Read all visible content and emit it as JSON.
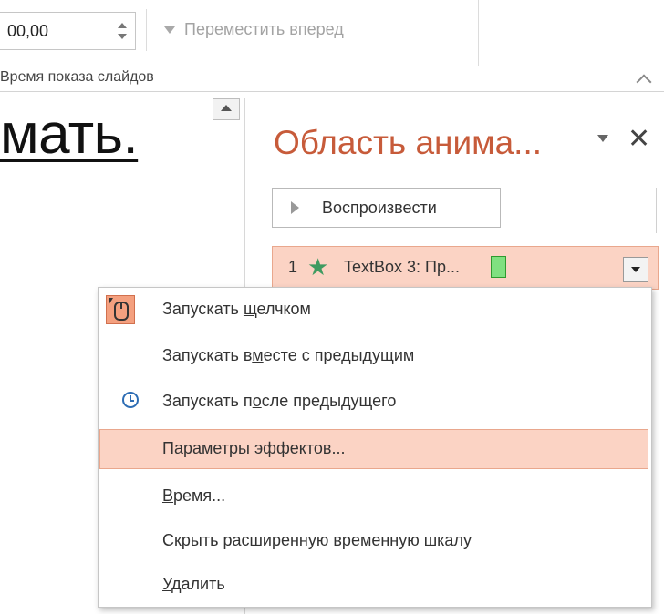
{
  "ribbon": {
    "duration_value": "00,00",
    "move_forward_label": "Переместить вперед",
    "group_label": "Время показа слайдов"
  },
  "slide": {
    "visible_text": "мать."
  },
  "animation_pane": {
    "title": "Область анима...",
    "play_label": "Воспроизвести",
    "item": {
      "number": "1",
      "label": "TextBox 3: Пр..."
    }
  },
  "context_menu": {
    "items": [
      {
        "before": "Запускать ",
        "underline": "щ",
        "after": "елчком",
        "icon": "mouse-click-icon",
        "highlighted": false
      },
      {
        "before": "Запускать в",
        "underline": "м",
        "after": "есте с предыдущим",
        "icon": "",
        "highlighted": false
      },
      {
        "before": "Запускать п",
        "underline": "о",
        "after": "сле предыдущего",
        "icon": "clock-icon",
        "highlighted": false
      },
      {
        "before": "",
        "underline": "П",
        "after": "араметры эффектов...",
        "icon": "",
        "highlighted": true
      },
      {
        "before": "",
        "underline": "В",
        "after": "ремя...",
        "icon": "",
        "highlighted": false
      },
      {
        "before": "",
        "underline": "С",
        "after": "крыть расширенную временную шкалу",
        "icon": "",
        "highlighted": false
      },
      {
        "before": "",
        "underline": "У",
        "after": "далить",
        "icon": "",
        "highlighted": false
      }
    ]
  },
  "colors": {
    "accent_title": "#c75b3a",
    "highlight_bg": "#fbd3c4",
    "star_green": "#3f9b61"
  }
}
